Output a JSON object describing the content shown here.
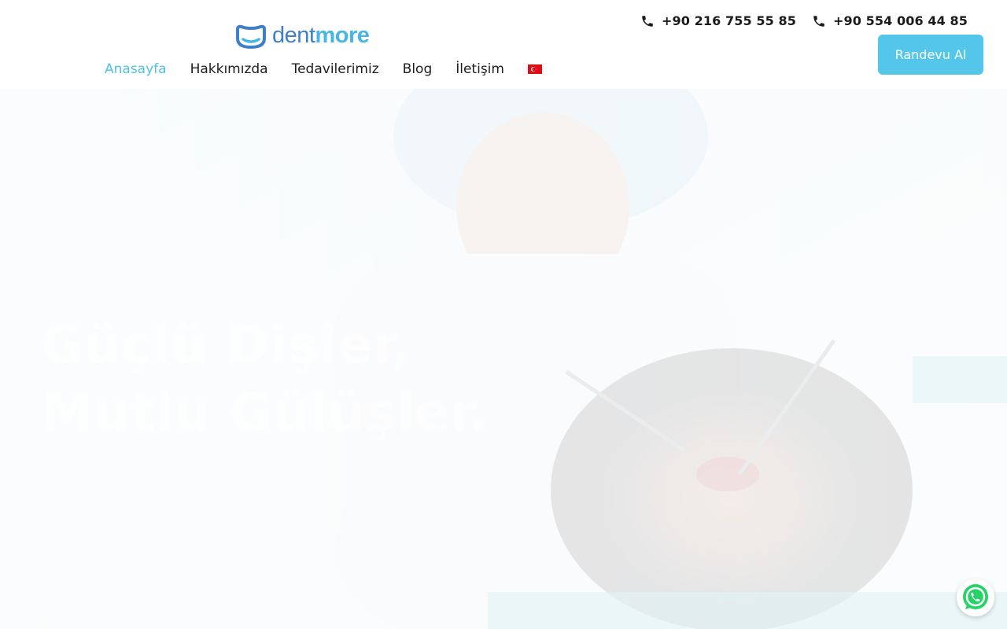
{
  "brand": {
    "logo_part1": "dent",
    "logo_part2": "more",
    "colors": {
      "primary": "#3f7fc9",
      "accent": "#47b6e6",
      "button": "#54c6ea"
    }
  },
  "nav": {
    "items": [
      {
        "label": "Anasayfa",
        "active": true
      },
      {
        "label": "Hakkımızda",
        "active": false
      },
      {
        "label": "Tedavilerimiz",
        "active": false
      },
      {
        "label": "Blog",
        "active": false
      },
      {
        "label": "İletişim",
        "active": false
      }
    ],
    "language_flag": "turkey-flag-icon"
  },
  "contacts": [
    {
      "icon": "phone-icon",
      "number": "+90 216 755 55 85"
    },
    {
      "icon": "phone-icon",
      "number": "+90 554 006 44 85"
    }
  ],
  "cta": {
    "label": "Randevu Al"
  },
  "hero": {
    "title_line1": "Güçlü Dişler,",
    "title_line2": "Mutlu Gülüşler."
  },
  "floating": {
    "icon": "whatsapp-icon"
  }
}
